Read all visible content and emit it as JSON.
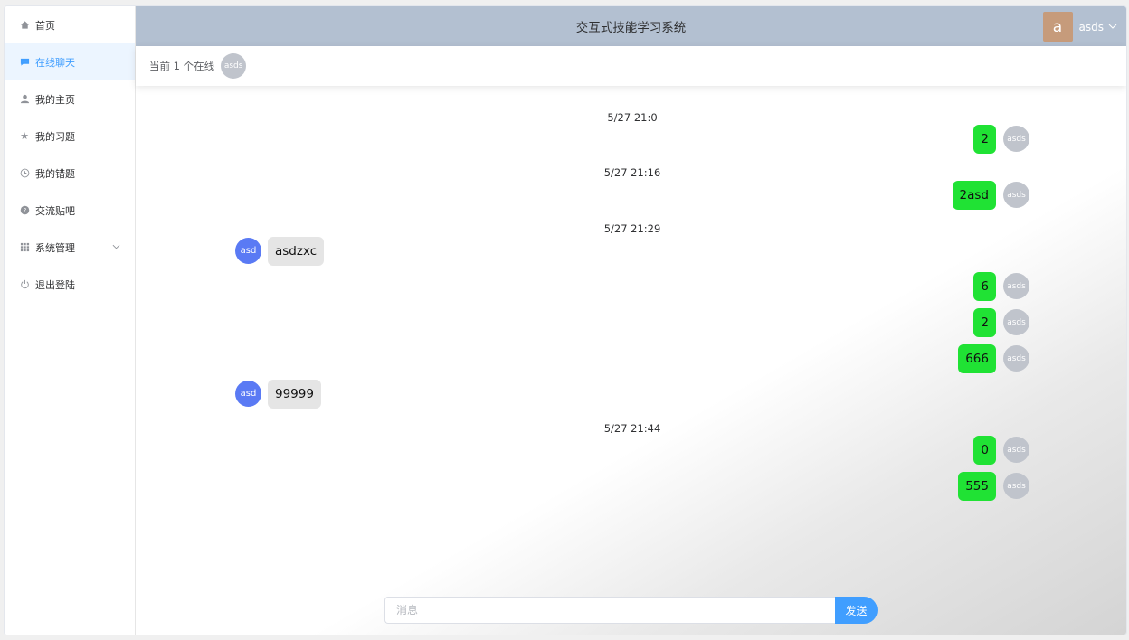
{
  "header": {
    "title": "交互式技能学习系统",
    "avatar_letter": "a",
    "username": "asds",
    "chevron": "chevron-down-icon"
  },
  "sidebar": {
    "items": [
      {
        "label": "首页",
        "icon": "home-icon",
        "active": false
      },
      {
        "label": "在线聊天",
        "icon": "chat-icon",
        "active": true
      },
      {
        "label": "我的主页",
        "icon": "user-icon",
        "active": false
      },
      {
        "label": "我的习题",
        "icon": "star-icon",
        "active": false
      },
      {
        "label": "我的错题",
        "icon": "clock-icon",
        "active": false
      },
      {
        "label": "交流贴吧",
        "icon": "help-icon",
        "active": false
      },
      {
        "label": "系统管理",
        "icon": "grid-icon",
        "active": false
      },
      {
        "label": "退出登陆",
        "icon": "power-icon",
        "active": false
      }
    ]
  },
  "online": {
    "text": "当前 1 个在线",
    "users": [
      "asds"
    ]
  },
  "chat": {
    "timestamps": [
      "5/27 21:0",
      "5/27 21:16",
      "5/27 21:29",
      "5/27 21:44"
    ],
    "messages": [
      {
        "from": "mine",
        "avatar": "asds",
        "text": "2"
      },
      {
        "from": "mine",
        "avatar": "asds",
        "text": "2asd"
      },
      {
        "from": "other",
        "avatar": "asd",
        "text": "asdzxc"
      },
      {
        "from": "mine",
        "avatar": "asds",
        "text": "6"
      },
      {
        "from": "mine",
        "avatar": "asds",
        "text": "2"
      },
      {
        "from": "mine",
        "avatar": "asds",
        "text": "666"
      },
      {
        "from": "other",
        "avatar": "asd",
        "text": "99999"
      },
      {
        "from": "mine",
        "avatar": "asds",
        "text": "0"
      },
      {
        "from": "mine",
        "avatar": "asds",
        "text": "555"
      }
    ]
  },
  "composer": {
    "placeholder": "消息",
    "send_label": "发送"
  },
  "colors": {
    "header_bg": "#b3c0d1",
    "active": "#409eff",
    "my_bubble": "#20e234",
    "other_bubble": "#e5e5e5",
    "other_avatar": "#5a7af4"
  }
}
